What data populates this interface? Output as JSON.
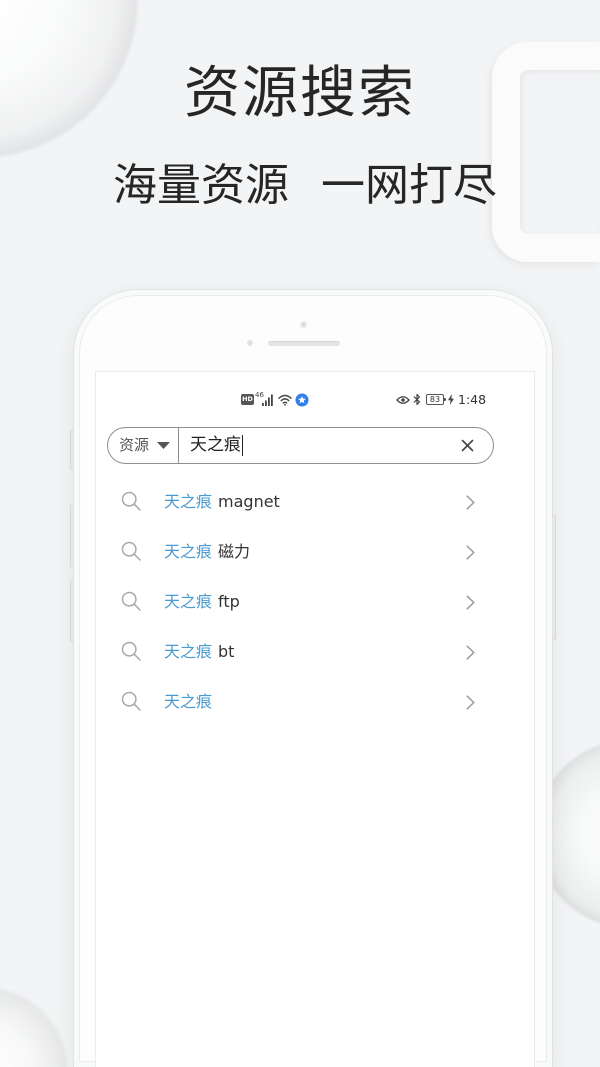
{
  "promo": {
    "title": "资源搜索",
    "subtitle": "海量资源 一网打尽"
  },
  "status_bar": {
    "hd_badge": "HD",
    "network": "46",
    "battery_level": "83",
    "time": "1:48",
    "icons": [
      "hd-badge-icon",
      "signal-icon",
      "wifi-icon",
      "app-notification-icon",
      "eye-icon",
      "bluetooth-icon",
      "battery-icon",
      "charging-icon"
    ]
  },
  "search": {
    "category": "资源",
    "query": "天之痕",
    "icons": {
      "dropdown": "caret-down-icon",
      "clear": "close-icon"
    }
  },
  "suggestions": [
    {
      "keyword": "天之痕",
      "suffix": "magnet"
    },
    {
      "keyword": "天之痕",
      "suffix": "磁力"
    },
    {
      "keyword": "天之痕",
      "suffix": "ftp"
    },
    {
      "keyword": "天之痕",
      "suffix": "bt"
    },
    {
      "keyword": "天之痕"
    }
  ],
  "suggestion_icons": {
    "leading": "search-icon",
    "trailing": "chevron-right-icon"
  },
  "colors": {
    "background": "#f3f4f5",
    "title_text": "#262626",
    "body_text": "#333333",
    "keyword_highlight": "#4a9bd1",
    "notification_blue": "#2f7fe8"
  }
}
